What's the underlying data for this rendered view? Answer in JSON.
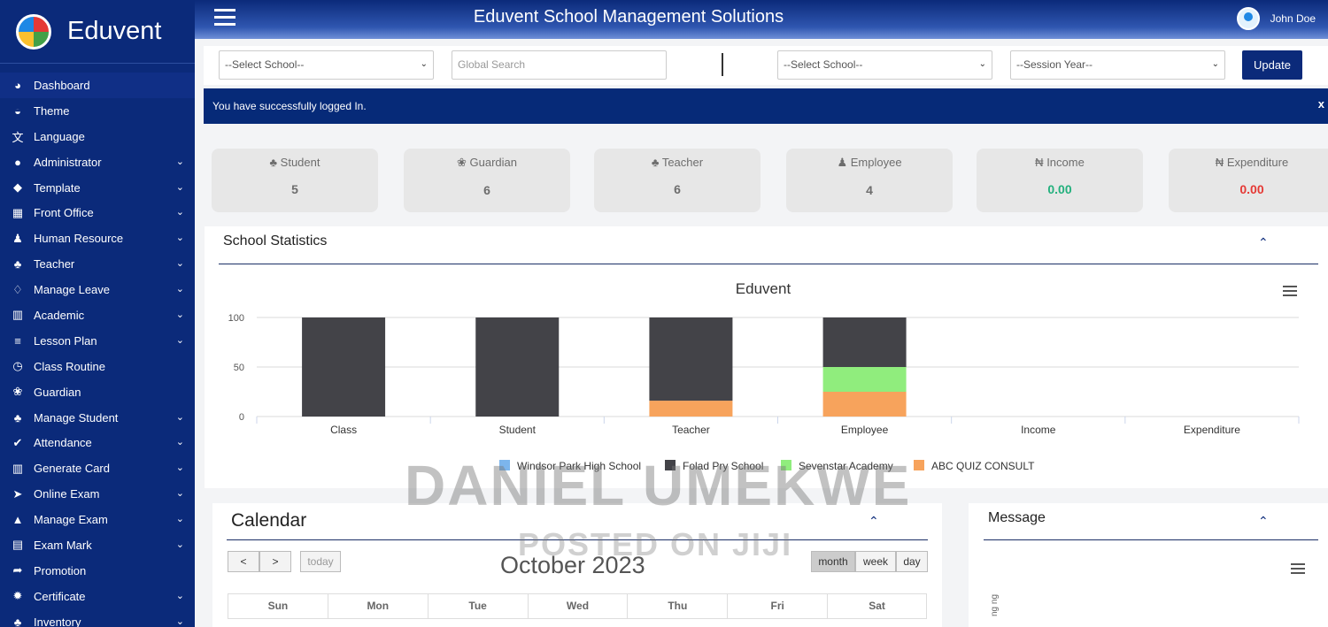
{
  "sidebar": {
    "brand": "Eduvent",
    "items": [
      {
        "label": "Dashboard",
        "icon": "dashboard-icon",
        "glyph": "◕",
        "chevron": false
      },
      {
        "label": "Theme",
        "icon": "theme-icon",
        "glyph": "◒",
        "chevron": false
      },
      {
        "label": "Language",
        "icon": "language-icon",
        "glyph": "文",
        "chevron": false
      },
      {
        "label": "Administrator",
        "icon": "user-icon",
        "glyph": "●",
        "chevron": true
      },
      {
        "label": "Template",
        "icon": "tag-icon",
        "glyph": "◆",
        "chevron": true
      },
      {
        "label": "Front Office",
        "icon": "office-icon",
        "glyph": "▦",
        "chevron": true
      },
      {
        "label": "Human Resource",
        "icon": "human-resource-icon",
        "glyph": "♟",
        "chevron": true
      },
      {
        "label": "Teacher",
        "icon": "teacher-icon",
        "glyph": "♣",
        "chevron": true
      },
      {
        "label": "Manage Leave",
        "icon": "bell-icon",
        "glyph": "♢",
        "chevron": true
      },
      {
        "label": "Academic",
        "icon": "bank-icon",
        "glyph": "▥",
        "chevron": true
      },
      {
        "label": "Lesson Plan",
        "icon": "list-icon",
        "glyph": "≡",
        "chevron": true
      },
      {
        "label": "Class Routine",
        "icon": "clock-icon",
        "glyph": "◷",
        "chevron": false
      },
      {
        "label": "Guardian",
        "icon": "paw-icon",
        "glyph": "❀",
        "chevron": false
      },
      {
        "label": "Manage Student",
        "icon": "students-icon",
        "glyph": "♣",
        "chevron": true
      },
      {
        "label": "Attendance",
        "icon": "check-circle-icon",
        "glyph": "✔",
        "chevron": true
      },
      {
        "label": "Generate Card",
        "icon": "barcode-icon",
        "glyph": "▥",
        "chevron": true
      },
      {
        "label": "Online Exam",
        "icon": "cursor-icon",
        "glyph": "➤",
        "chevron": true
      },
      {
        "label": "Manage Exam",
        "icon": "graduation-cap-icon",
        "glyph": "▲",
        "chevron": true
      },
      {
        "label": "Exam Mark",
        "icon": "document-icon",
        "glyph": "▤",
        "chevron": true
      },
      {
        "label": "Promotion",
        "icon": "share-icon",
        "glyph": "➦",
        "chevron": false
      },
      {
        "label": "Certificate",
        "icon": "certificate-icon",
        "glyph": "✹",
        "chevron": true
      },
      {
        "label": "Inventory",
        "icon": "inventory-icon",
        "glyph": "♣",
        "chevron": true
      }
    ]
  },
  "topbar": {
    "title": "Eduvent School Management Solutions",
    "user": "John Doe"
  },
  "filters": {
    "school_select_1": "--Select School--",
    "search_placeholder": "Global Search",
    "school_select_2": "--Select School--",
    "session_select": "--Session Year--",
    "update_label": "Update"
  },
  "alert": {
    "message": "You have successfully logged In.",
    "close": "x"
  },
  "cards": [
    {
      "label": "Student",
      "icon": "students-icon",
      "glyph": "♣",
      "value": "5",
      "color": "#6d6d6d"
    },
    {
      "label": "Guardian",
      "icon": "paw-icon",
      "glyph": "❀",
      "value": "6",
      "color": "#6d6d6d"
    },
    {
      "label": "Teacher",
      "icon": "teacher-icon",
      "glyph": "♣",
      "value": "6",
      "color": "#6d6d6d"
    },
    {
      "label": "Employee",
      "icon": "employee-icon",
      "glyph": "♟",
      "value": "4",
      "color": "#6d6d6d"
    },
    {
      "label": "Income",
      "icon": "naira-icon",
      "glyph": "₦",
      "value": "0.00",
      "color": "#23b07d"
    },
    {
      "label": "Expenditure",
      "icon": "naira-icon",
      "glyph": "₦",
      "value": "0.00",
      "color": "#e53935"
    }
  ],
  "stats": {
    "title": "School Statistics"
  },
  "chart_data": {
    "type": "bar",
    "stacked": true,
    "title": "Eduvent",
    "categories": [
      "Class",
      "Student",
      "Teacher",
      "Employee",
      "Income",
      "Expenditure"
    ],
    "ylim": [
      0,
      100
    ],
    "yticks": [
      0,
      50,
      100
    ],
    "grid": true,
    "legend_position": "bottom",
    "series": [
      {
        "name": "Windsor Park High School",
        "color": "#7cb5ec",
        "values": [
          0,
          0,
          0,
          0,
          0,
          0
        ]
      },
      {
        "name": "Folad Pry School",
        "color": "#434348",
        "values": [
          100,
          100,
          84,
          50,
          0,
          0
        ]
      },
      {
        "name": "Sevenstar Academy",
        "color": "#90ed7d",
        "values": [
          0,
          0,
          0,
          25,
          0,
          0
        ]
      },
      {
        "name": "ABC QUIZ CONSULT",
        "color": "#f7a35c",
        "values": [
          0,
          0,
          16,
          25,
          0,
          0
        ]
      }
    ]
  },
  "calendar": {
    "title": "Calendar",
    "month": "October 2023",
    "prev": "<",
    "next": ">",
    "today": "today",
    "views": [
      "month",
      "week",
      "day"
    ],
    "days": [
      "Sun",
      "Mon",
      "Tue",
      "Wed",
      "Thu",
      "Fri",
      "Sat"
    ]
  },
  "message": {
    "title": "Message",
    "axis_fragment": "ng ng"
  },
  "watermark": {
    "line1": "DANIEL UMEKWE",
    "line2": "POSTED ON JIJI"
  }
}
